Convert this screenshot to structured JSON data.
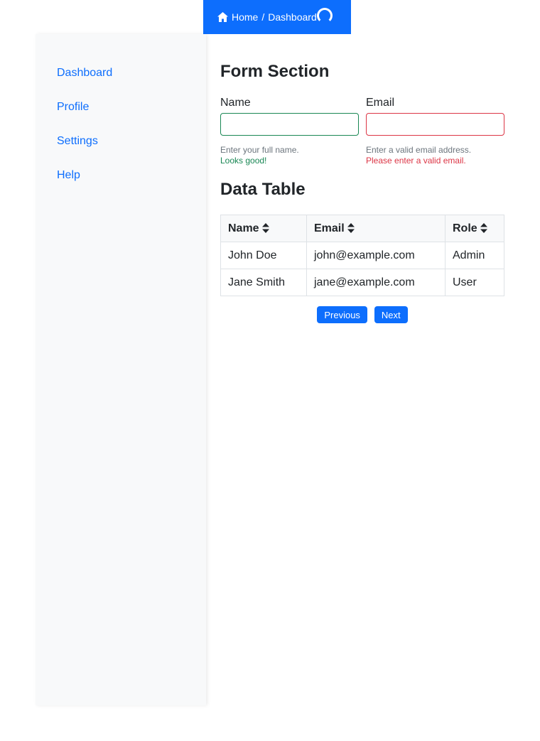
{
  "breadcrumb": {
    "home_icon": "home-icon",
    "home": "Home",
    "separator": "/",
    "current": "Dashboard",
    "spinner_icon": "loading-spinner-icon"
  },
  "sidebar": {
    "items": [
      {
        "label": "Dashboard"
      },
      {
        "label": "Profile"
      },
      {
        "label": "Settings"
      },
      {
        "label": "Help"
      }
    ]
  },
  "form": {
    "title": "Form Section",
    "name": {
      "label": "Name",
      "value": "",
      "help": "Enter your full name.",
      "feedback": "Looks good!",
      "state": "valid"
    },
    "email": {
      "label": "Email",
      "value": "",
      "help": "Enter a valid email address.",
      "feedback": "Please enter a valid email.",
      "state": "invalid"
    }
  },
  "table": {
    "title": "Data Table",
    "sort_icon": "sort-icon",
    "headers": [
      "Name",
      "Email",
      "Role"
    ],
    "rows": [
      [
        "John Doe",
        "john@example.com",
        "Admin"
      ],
      [
        "Jane Smith",
        "jane@example.com",
        "User"
      ]
    ]
  },
  "pagination": {
    "previous": "Previous",
    "next": "Next"
  },
  "colors": {
    "primary": "#0d6efd",
    "valid": "#198754",
    "invalid": "#dc3545",
    "sidebar_bg": "#f8f9fa"
  }
}
